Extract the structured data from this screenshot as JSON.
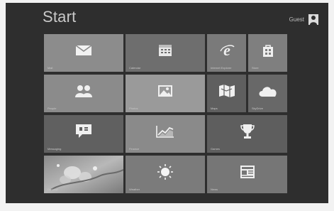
{
  "header": {
    "title": "Start",
    "user_name": "Guest"
  },
  "tiles": {
    "mail": {
      "label": "Mail",
      "color": "#8c8c8c"
    },
    "calendar": {
      "label": "Calendar",
      "color": "#6e6e6e"
    },
    "internet_explorer": {
      "label": "Internet Explorer",
      "color": "#7a7a7a"
    },
    "store": {
      "label": "Store",
      "color": "#7f7f7f"
    },
    "people": {
      "label": "People",
      "color": "#8b8b8b"
    },
    "photos": {
      "label": "Photos",
      "color": "#9a9a9a"
    },
    "maps": {
      "label": "Maps",
      "color": "#5f5f5f"
    },
    "skydrive": {
      "label": "SkyDrive",
      "color": "#686868"
    },
    "messaging": {
      "label": "Messaging",
      "color": "#606060"
    },
    "finance": {
      "label": "Finance",
      "color": "#8a8a8a"
    },
    "games": {
      "label": "Games",
      "color": "#5e5e5e"
    },
    "desktop": {
      "label": "Desktop",
      "color": "#a0a0a0"
    },
    "weather": {
      "label": "Weather",
      "color": "#7b7b7b"
    },
    "news": {
      "label": "News",
      "color": "#767676"
    }
  }
}
